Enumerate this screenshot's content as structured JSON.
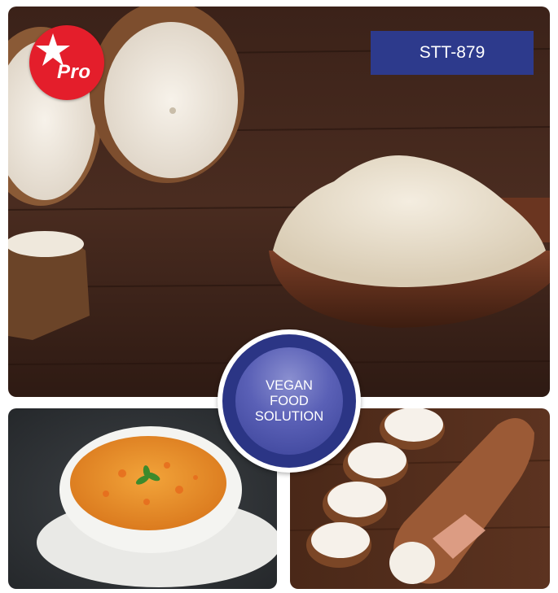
{
  "product_code": "STT-879",
  "pro_badge": {
    "text": "Pro",
    "icon": "star-icon"
  },
  "vegan_seal": {
    "lines": [
      "VEGAN",
      "FOOD",
      "SOLUTION"
    ]
  },
  "colors": {
    "brand_blue": "#2d3a8c",
    "badge_red": "#e41e2b",
    "wood_dark": "#3a2118"
  }
}
